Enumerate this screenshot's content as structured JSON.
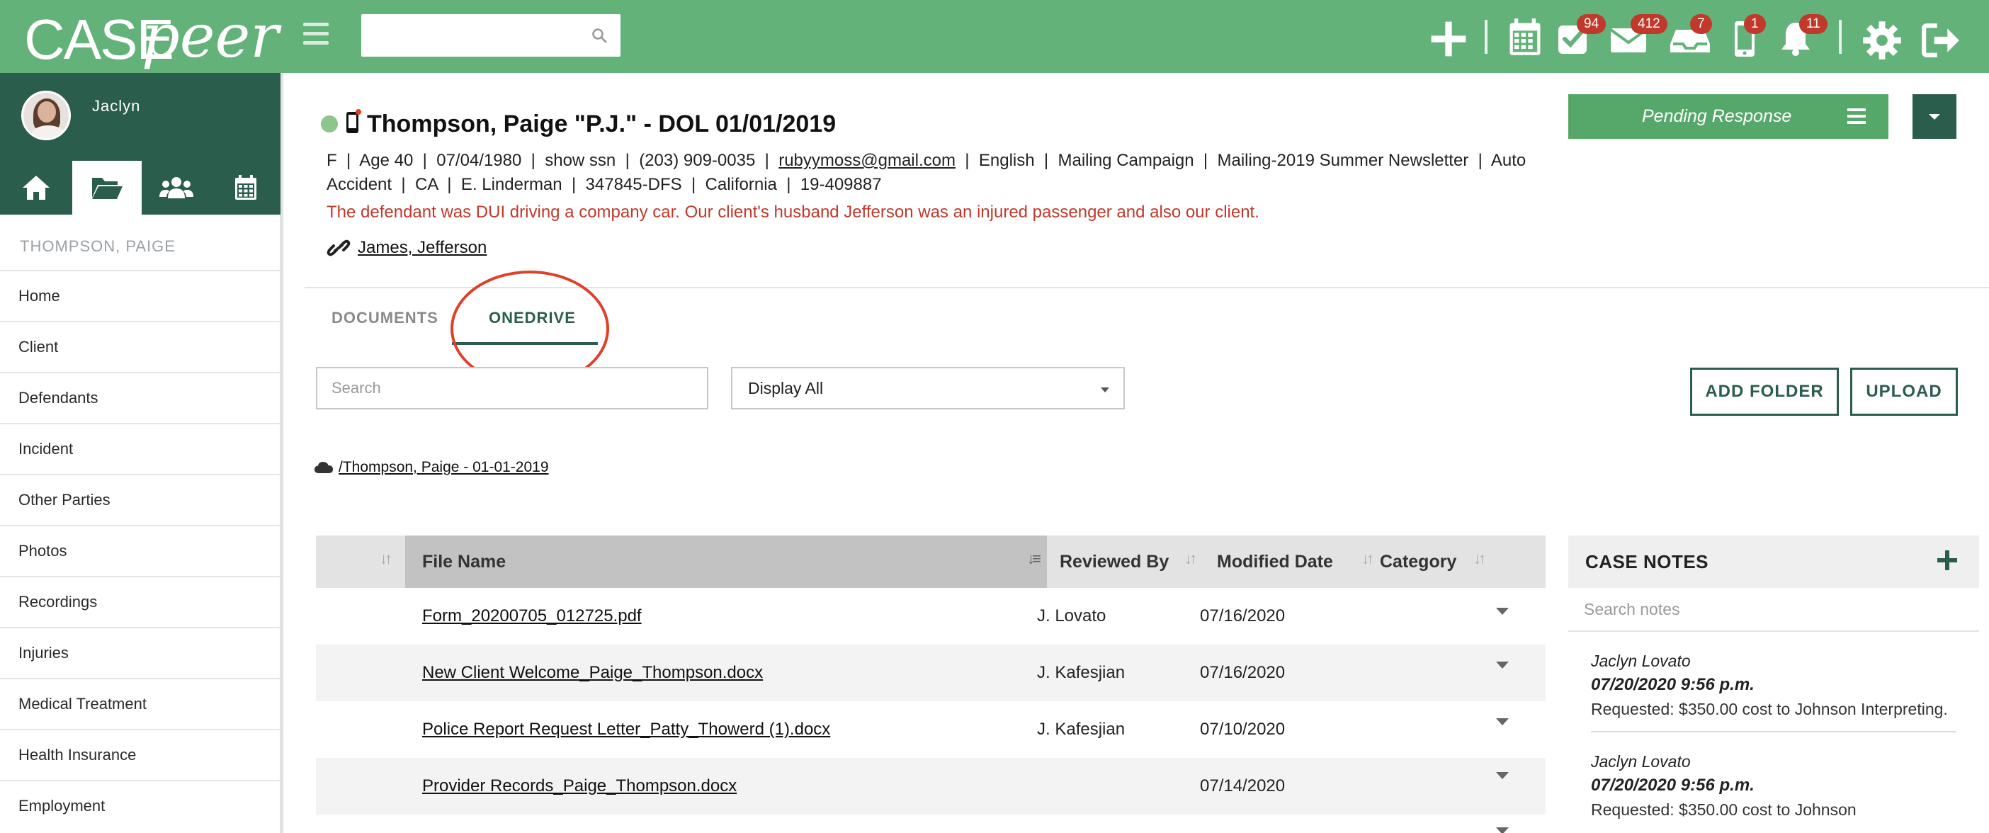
{
  "app": {
    "logo_case": "CASE",
    "logo_peer": "peer"
  },
  "topbar": {
    "search_placeholder": "",
    "badges": {
      "tasks": "94",
      "mail": "412",
      "inbox": "7",
      "phone": "1",
      "notifications": "11"
    }
  },
  "sidebar": {
    "user_name": "Jaclyn",
    "heading": "THOMPSON, PAIGE",
    "items": [
      {
        "label": "Home"
      },
      {
        "label": "Client"
      },
      {
        "label": "Defendants"
      },
      {
        "label": "Incident"
      },
      {
        "label": "Other Parties"
      },
      {
        "label": "Photos"
      },
      {
        "label": "Recordings"
      },
      {
        "label": "Injuries"
      },
      {
        "label": "Medical Treatment"
      },
      {
        "label": "Health Insurance"
      },
      {
        "label": "Employment"
      }
    ]
  },
  "case": {
    "title": "Thompson, Paige \"P.J.\" - DOL 01/01/2019",
    "info_line1_pre": "F  |  Age 40  |  07/04/1980  |  show ssn  |  (203) 909-0035  |  ",
    "email": "rubyymoss@gmail.com",
    "info_line1_post": "  |  English  |  Mailing Campaign  |  Mailing-2019 Summer Newsletter  |  Auto",
    "info_line2": "Accident  |  CA  |  E. Linderman  |  347845-DFS  |  California  |  19-409887",
    "description": "The defendant was DUI driving a company car. Our client's husband Jefferson was an injured passenger and also our client.",
    "linked_case": "James, Jefferson",
    "status": "Pending Response"
  },
  "tabs": {
    "documents": "DOCUMENTS",
    "onedrive": "ONEDRIVE"
  },
  "filters": {
    "search_placeholder": "Search",
    "display_value": "Display All",
    "add_folder": "ADD FOLDER",
    "upload": "UPLOAD"
  },
  "path": "/Thompson, Paige - 01-01-2019",
  "table": {
    "columns": {
      "file_name": "File Name",
      "reviewed_by": "Reviewed By",
      "modified_date": "Modified Date",
      "category": "Category"
    },
    "rows": [
      {
        "file_name": "Form_20200705_012725.pdf",
        "reviewed_by": "J. Lovato",
        "modified_date": "07/16/2020",
        "category": ""
      },
      {
        "file_name": "New Client Welcome_Paige_Thompson.docx",
        "reviewed_by": "J. Kafesjian",
        "modified_date": "07/16/2020",
        "category": ""
      },
      {
        "file_name": "Police Report Request Letter_Patty_Thowerd (1).docx",
        "reviewed_by": "J. Kafesjian",
        "modified_date": "07/10/2020",
        "category": ""
      },
      {
        "file_name": "Provider Records_Paige_Thompson.docx",
        "reviewed_by": "",
        "modified_date": "07/14/2020",
        "category": ""
      }
    ]
  },
  "notes": {
    "title": "CASE NOTES",
    "search_placeholder": "Search notes",
    "items": [
      {
        "author": "Jaclyn Lovato",
        "time": "07/20/2020 9:56 p.m.",
        "text": "Requested: $350.00 cost to Johnson Interpreting."
      },
      {
        "author": "Jaclyn Lovato",
        "time": "07/20/2020 9:56 p.m.",
        "text": "Requested: $350.00 cost to Johnson"
      }
    ]
  }
}
